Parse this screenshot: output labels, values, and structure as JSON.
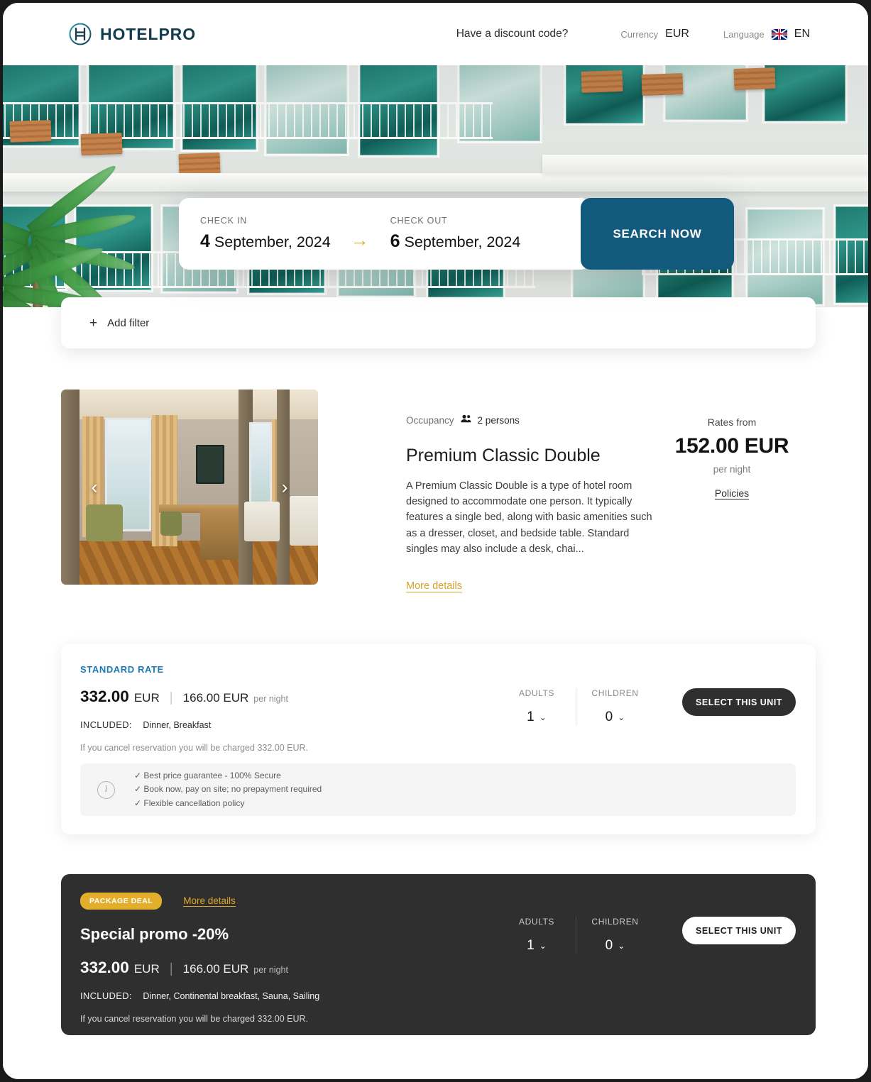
{
  "header": {
    "logo_text": "HOTELPRO",
    "discount_link": "Have a discount code?",
    "currency_label": "Currency",
    "currency_value": "EUR",
    "language_label": "Language",
    "language_value": "EN"
  },
  "search": {
    "checkin_label": "CHECK IN",
    "checkin_day": "4",
    "checkin_rest": "September, 2024",
    "checkout_label": "CHECK OUT",
    "checkout_day": "6",
    "checkout_rest": "September, 2024",
    "arrow": "→",
    "button": "SEARCH NOW"
  },
  "filters": {
    "add_filter": "Add filter",
    "plus": "+"
  },
  "room": {
    "occupancy_label": "Occupancy",
    "occupancy_value": "2 persons",
    "title": "Premium Classic Double",
    "description": "A Premium Classic Double is a type of hotel room designed to accommodate one person. It typically features a single bed, along with basic amenities such as a dresser, closet, and bedside table. Standard singles may also include a desk, chai...",
    "more_details": "More details",
    "prev_arrow": "‹",
    "next_arrow": "›",
    "rates_from_label": "Rates from",
    "rates_from_price": "152.00 EUR",
    "per_night": "per night",
    "policies": "Policies"
  },
  "standard_rate": {
    "tag": "STANDARD RATE",
    "total_price": "332.00",
    "total_currency": "EUR",
    "divider": "|",
    "unit_price": "166.00 EUR",
    "per_night": "per night",
    "included_label": "INCLUDED:",
    "included_value": "Dinner, Breakfast",
    "cancel_note": "If you cancel reservation you will be charged 332.00 EUR.",
    "adults_label": "ADULTS",
    "adults_value": "1",
    "children_label": "CHILDREN",
    "children_value": "0",
    "chevron": "⌄",
    "select_button": "SELECT THIS UNIT",
    "guarantee": [
      "✓ Best price guarantee - 100% Secure",
      "✓ Book now, pay on site; no prepayment required",
      "✓ Flexible cancellation policy"
    ]
  },
  "package_deal": {
    "badge": "PACKAGE DEAL",
    "more_details": "More details",
    "title": "Special promo -20%",
    "total_price": "332.00",
    "total_currency": "EUR",
    "divider": "|",
    "unit_price": "166.00 EUR",
    "per_night": "per night",
    "included_label": "INCLUDED:",
    "included_value": "Dinner, Continental breakfast, Sauna, Sailing",
    "cancel_note": "If you cancel reservation you will be charged 332.00 EUR.",
    "adults_label": "ADULTS",
    "adults_value": "1",
    "children_label": "CHILDREN",
    "children_value": "0",
    "chevron": "⌄",
    "select_button": "SELECT THIS UNIT"
  },
  "colors": {
    "brand_navy": "#123b4f",
    "search_button": "#12597e",
    "gold": "#d3a229",
    "badge_gold": "#e3ae2c",
    "rate_tag_blue": "#1d7ab5",
    "dark_card": "#2f2f2f"
  }
}
